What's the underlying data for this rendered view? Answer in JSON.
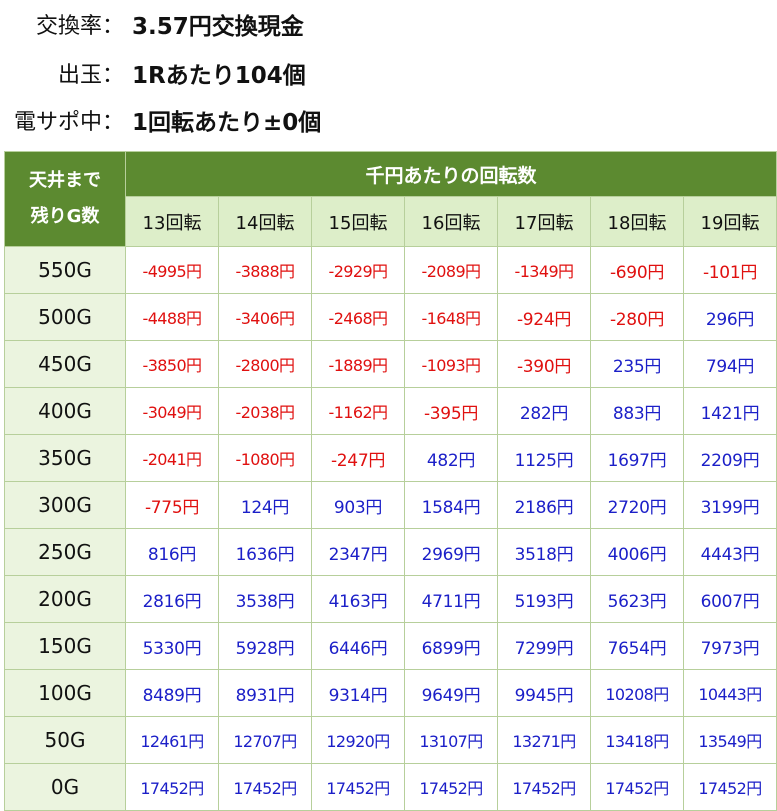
{
  "info": [
    {
      "label": "交換率：",
      "value": "3.57円交換現金"
    },
    {
      "label": "出玉：",
      "value": "1Rあたり104個"
    },
    {
      "label": "電サポ中：",
      "value": "1回転あたり±0個"
    }
  ],
  "table": {
    "corner_line1": "天井まで",
    "corner_line2": "残りG数",
    "top_header": "千円あたりの回転数",
    "columns": [
      "13回転",
      "14回転",
      "15回転",
      "16回転",
      "17回転",
      "18回転",
      "19回転"
    ],
    "rows": [
      {
        "label": "550G",
        "values": [
          "-4995円",
          "-3888円",
          "-2929円",
          "-2089円",
          "-1349円",
          "-690円",
          "-101円"
        ]
      },
      {
        "label": "500G",
        "values": [
          "-4488円",
          "-3406円",
          "-2468円",
          "-1648円",
          "-924円",
          "-280円",
          "296円"
        ]
      },
      {
        "label": "450G",
        "values": [
          "-3850円",
          "-2800円",
          "-1889円",
          "-1093円",
          "-390円",
          "235円",
          "794円"
        ]
      },
      {
        "label": "400G",
        "values": [
          "-3049円",
          "-2038円",
          "-1162円",
          "-395円",
          "282円",
          "883円",
          "1421円"
        ]
      },
      {
        "label": "350G",
        "values": [
          "-2041円",
          "-1080円",
          "-247円",
          "482円",
          "1125円",
          "1697円",
          "2209円"
        ]
      },
      {
        "label": "300G",
        "values": [
          "-775円",
          "124円",
          "903円",
          "1584円",
          "2186円",
          "2720円",
          "3199円"
        ]
      },
      {
        "label": "250G",
        "values": [
          "816円",
          "1636円",
          "2347円",
          "2969円",
          "3518円",
          "4006円",
          "4443円"
        ]
      },
      {
        "label": "200G",
        "values": [
          "2816円",
          "3538円",
          "4163円",
          "4711円",
          "5193円",
          "5623円",
          "6007円"
        ]
      },
      {
        "label": "150G",
        "values": [
          "5330円",
          "5928円",
          "6446円",
          "6899円",
          "7299円",
          "7654円",
          "7973円"
        ]
      },
      {
        "label": "100G",
        "values": [
          "8489円",
          "8931円",
          "9314円",
          "9649円",
          "9945円",
          "10208円",
          "10443円"
        ]
      },
      {
        "label": "50G",
        "values": [
          "12461円",
          "12707円",
          "12920円",
          "13107円",
          "13271円",
          "13418円",
          "13549円"
        ]
      },
      {
        "label": "0G",
        "values": [
          "17452円",
          "17452円",
          "17452円",
          "17452円",
          "17452円",
          "17452円",
          "17452円"
        ]
      }
    ]
  },
  "colors": {
    "header_green": "#5c8a30",
    "negative": "#e0100f",
    "positive": "#1b1fc8"
  }
}
